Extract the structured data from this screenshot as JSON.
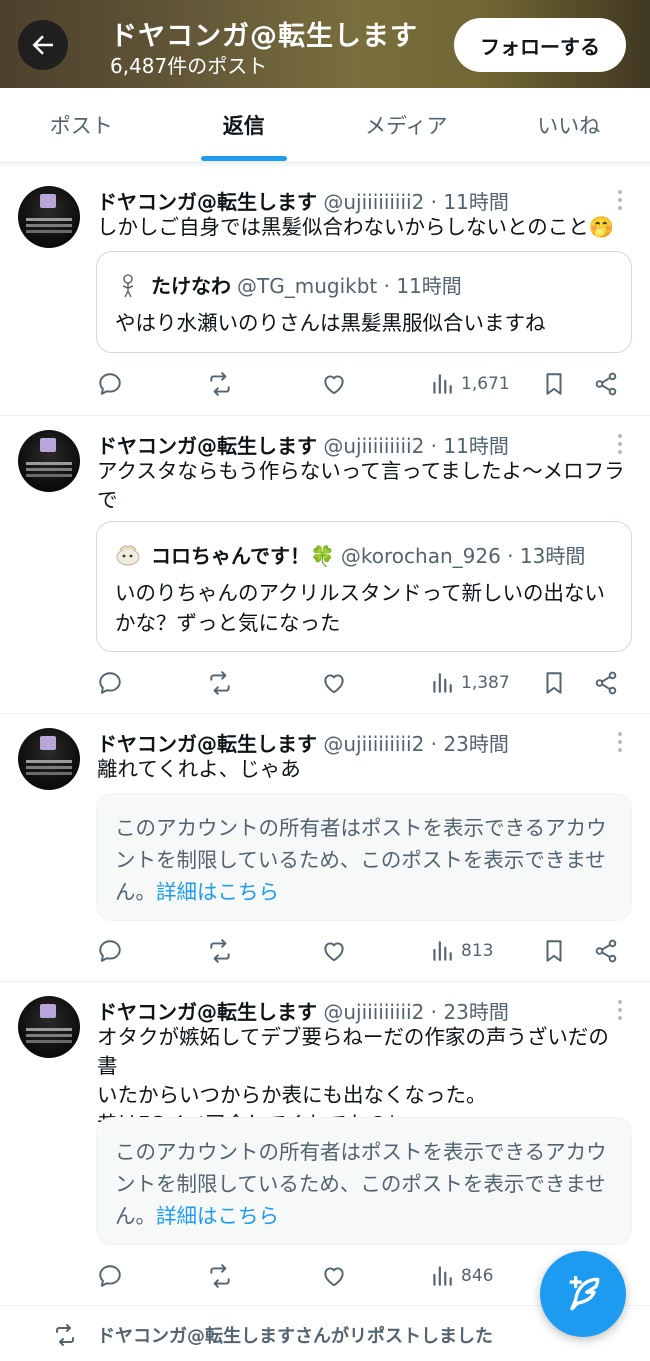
{
  "header": {
    "title": "ドヤコンガ@転生します",
    "post_count": "6,487件のポスト",
    "follow_label": "フォローする"
  },
  "tabs": [
    {
      "label": "ポスト",
      "active": false
    },
    {
      "label": "返信",
      "active": true
    },
    {
      "label": "メディア",
      "active": false
    },
    {
      "label": "いいね",
      "active": false
    }
  ],
  "posts": [
    {
      "name": "ドヤコンガ@転生します",
      "meta": "@ujiiiiiiiii2 · 11時間",
      "text": "しかしご自身では黒髪似合わないからしないとのこと🤭",
      "quote": {
        "name": "たけなわ",
        "meta": "@TG_mugikbt · 11時間",
        "text": "やはり水瀬いのりさんは黒髪黒服似合いますね"
      },
      "views": "1,671"
    },
    {
      "name": "ドヤコンガ@転生します",
      "meta": "@ujiiiiiiiii2 · 11時間",
      "text": "アクスタならもう作らないって言ってましたよ〜メロフラ\nで",
      "quote": {
        "name": "コロちゃんです！🍀",
        "meta": "@korochan_926 · 13時間",
        "text": "いのりちゃんのアクリルスタンドって新しいの出ない\nかな？ずっと気になった"
      },
      "views": "1,387"
    },
    {
      "name": "ドヤコンガ@転生します",
      "meta": "@ujiiiiiiiii2 · 23時間",
      "text": "離れてくれよ、じゃあ",
      "blocked_text": "このアカウントの所有者はポストを表示できるアカウントを制限しているため、このポストを表示できません。",
      "blocked_link": "詳細はこちら",
      "views": "813"
    },
    {
      "name": "ドヤコンガ@転生します",
      "meta": "@ujiiiiiiiii2 · 23時間",
      "text": "オタクが嫉妬してデブ要らねーだの作家の声うざいだの書\nいたからいつからか表にも出なくなった。\n昔はFCイベ司会してくれてたのに。。",
      "blocked_text": "このアカウントの所有者はポストを表示できるアカウントを制限しているため、このポストを表示できません。",
      "blocked_link": "詳細はこちら",
      "views": "846"
    }
  ],
  "repost_notice": "ドヤコンガ@転生しますさんがリポストしました",
  "colors": {
    "accent": "#1d9bf0",
    "text": "#0f1419",
    "muted": "#536471"
  }
}
